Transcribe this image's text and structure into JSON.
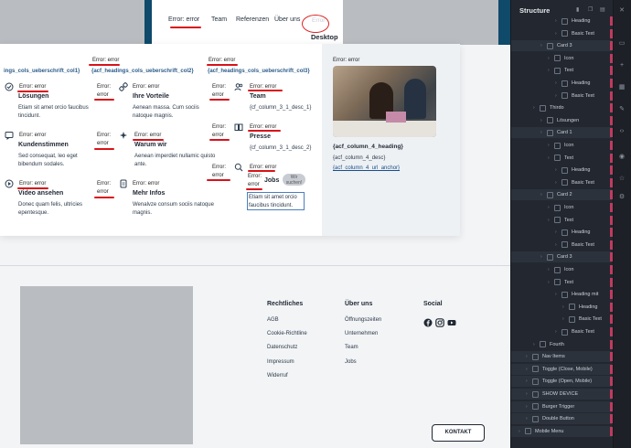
{
  "nav": {
    "error_label": "Error: error",
    "team": "Team",
    "referenzen": "Referenzen",
    "ueber_uns": "Über uns",
    "circled_text": "Error",
    "desktop": "Desktop"
  },
  "mega_menu": {
    "col1_heading": "ings_cols_ueberschrift_col1}",
    "col2_heading": "{acf_headings_cols_ueberschrift_col2}",
    "col3_heading": "{acf_headings_cols_ueberschrift_col3}",
    "error_text": "Error: error",
    "error_short": "Error:",
    "error_word": "error",
    "col1": [
      {
        "title": "Lösungen",
        "desc": "Etiam sit amet orcio faucibus tincidunt."
      },
      {
        "title": "Kundenstimmen",
        "desc": "Sed consequat, leo eget bibendum sodales."
      },
      {
        "title": "Video ansehen",
        "desc": "Donec quam felis, ultricies epentesque."
      }
    ],
    "col2": [
      {
        "title": "Ihre Vorteile",
        "desc": "Aenean massa. Cum sociis natoque magnis."
      },
      {
        "title": "Warum wir",
        "desc": "Aenean imperdiet nullamic quisto ante."
      },
      {
        "title": "Mehr Infos",
        "desc": "Wenalvze consum sociis natoque magnis."
      }
    ],
    "col3": [
      {
        "title": "Team",
        "desc": "{cf_column_3_1_desc_1}"
      },
      {
        "title": "Presse",
        "desc": "{cf_column_3_1_desc_2}"
      },
      {
        "title": "Jobs",
        "desc": "Etiam sit amet orcio faucibus tincidunt.",
        "badge": "Wir suchen!"
      }
    ],
    "col4": {
      "label": "Error: error",
      "heading": "{acf_column_4_heading}",
      "desc": "{acf_column_4_desc}",
      "link": "{acf_column_4_url_anchor}"
    }
  },
  "footer": {
    "rechtliches_heading": "Rechtliches",
    "rechtliches": [
      "AGB",
      "Cookie-Richtline",
      "Datenschutz",
      "Impressum",
      "Widerruf"
    ],
    "ueber_heading": "Über uns",
    "ueber": [
      "Öffnungszeiten",
      "Unternehmen",
      "Team",
      "Jobs"
    ],
    "social_heading": "Social",
    "social_icons": [
      "facebook-icon",
      "instagram-icon",
      "youtube-icon"
    ],
    "kontakt": "KONTAKT"
  },
  "structure": {
    "title": "Structure",
    "rows": [
      {
        "label": "Heading",
        "indent": 5
      },
      {
        "label": "Basic Text",
        "indent": 5
      },
      {
        "label": "Card 3",
        "indent": 3
      },
      {
        "label": "Icon",
        "indent": 4
      },
      {
        "label": "Text",
        "indent": 4
      },
      {
        "label": "Heading",
        "indent": 5
      },
      {
        "label": "Basic Text",
        "indent": 5
      },
      {
        "label": "Thirdo",
        "indent": 2
      },
      {
        "label": "Lösungen",
        "indent": 3
      },
      {
        "label": "Card 1",
        "indent": 3
      },
      {
        "label": "Icon",
        "indent": 4
      },
      {
        "label": "Text",
        "indent": 4
      },
      {
        "label": "Heading",
        "indent": 5
      },
      {
        "label": "Basic Text",
        "indent": 5
      },
      {
        "label": "Card 2",
        "indent": 3
      },
      {
        "label": "Icon",
        "indent": 4
      },
      {
        "label": "Text",
        "indent": 4
      },
      {
        "label": "Heading",
        "indent": 5
      },
      {
        "label": "Basic Text",
        "indent": 5
      },
      {
        "label": "Card 3",
        "indent": 3
      },
      {
        "label": "Icon",
        "indent": 4
      },
      {
        "label": "Text",
        "indent": 4
      },
      {
        "label": "Heading mit",
        "indent": 5
      },
      {
        "label": "Heading",
        "indent": 6
      },
      {
        "label": "Basic Text",
        "indent": 6
      },
      {
        "label": "Basic Text",
        "indent": 5
      },
      {
        "label": "Fourth",
        "indent": 2
      },
      {
        "label": "Nav Items",
        "indent": 1
      },
      {
        "label": "Toggle (Close, Mobile)",
        "indent": 1
      },
      {
        "label": "Toggle (Open, Mobile)",
        "indent": 1
      },
      {
        "label": "SHOW DEVICE",
        "indent": 1
      },
      {
        "label": "Burger Trigger",
        "indent": 1
      },
      {
        "label": "Double Button",
        "indent": 1
      },
      {
        "label": "Mobile Menu",
        "indent": 0
      }
    ]
  },
  "colors": {
    "topbar": "#0f4a6a",
    "accent_red": "#d8121a",
    "panel_bg": "#232830"
  }
}
